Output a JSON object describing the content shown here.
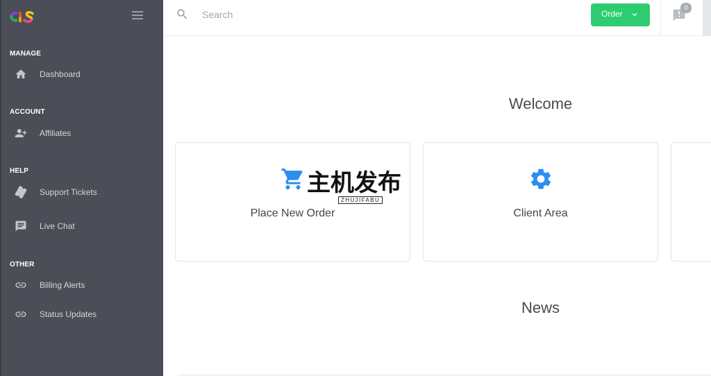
{
  "sidebar": {
    "logo": "brand-logo",
    "toggle_icon": "hamburger-menu-icon",
    "sections": [
      {
        "title": "MANAGE",
        "items": [
          {
            "label": "Dashboard",
            "icon": "home-icon"
          }
        ]
      },
      {
        "title": "ACCOUNT",
        "items": [
          {
            "label": "Affiliates",
            "icon": "person-add-icon"
          }
        ]
      },
      {
        "title": "HELP",
        "items": [
          {
            "label": "Support Tickets",
            "icon": "ticket-icon"
          },
          {
            "label": "Live Chat",
            "icon": "chat-icon"
          }
        ]
      },
      {
        "title": "OTHER",
        "items": [
          {
            "label": "Billing Alerts",
            "icon": "link-icon"
          },
          {
            "label": "Status Updates",
            "icon": "link-icon"
          }
        ]
      }
    ]
  },
  "header": {
    "search": {
      "icon": "search-icon",
      "placeholder": "Search",
      "value": ""
    },
    "order_button": {
      "label": "Order",
      "icon": "chevron-down-icon"
    },
    "notifications": {
      "icon": "announcement-icon",
      "count": "0"
    }
  },
  "main": {
    "welcome_title": "Welcome",
    "cards": [
      {
        "label": "Place New Order",
        "icon": "shopping-cart-icon"
      },
      {
        "label": "Client Area",
        "icon": "gear-icon"
      }
    ],
    "news_title": "News"
  },
  "watermark": {
    "text": "主机发布",
    "subtext": "ZHUJIFABU"
  },
  "colors": {
    "sidebar_bg": "#4b4e57",
    "order_button": "#2ecc71",
    "card_icon": "#2b8ef0",
    "heading_text": "#4a4a4a"
  }
}
